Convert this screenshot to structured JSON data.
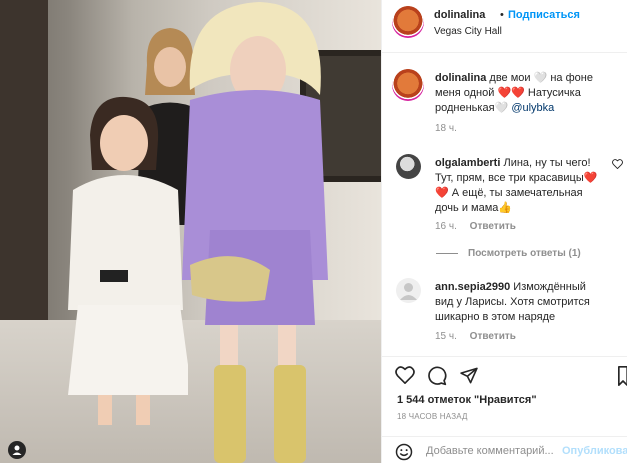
{
  "post_user": {
    "username": "dolinalina",
    "separator": "•",
    "follow_label": "Подписаться",
    "location": "Vegas City Hall"
  },
  "caption": {
    "username": "dolinalina",
    "text": "две мои 🤍 на фоне меня одной ❤️❤️ Натусичка родненькая🤍",
    "mention": "@ulybka",
    "time": "18 ч."
  },
  "comments": [
    {
      "username": "olgalamberti",
      "text": "Лина, ну ты чего! Тут, прям, все три красавицы❤️❤️ А ещё, ты замечательная дочь и мама👍",
      "time": "16 ч.",
      "reply_label": "Ответить"
    },
    {
      "username": "ann.sepia2990",
      "text": "Измождённый вид у Ларисы. Хотя смотрится шикарно в этом наряде",
      "time": "15 ч.",
      "reply_label": "Ответить"
    }
  ],
  "replies": {
    "label": "Посмотреть ответы (1)"
  },
  "actions": {
    "like_icon": "heart-icon",
    "comment_icon": "comment-icon",
    "share_icon": "share-icon",
    "save_icon": "bookmark-icon"
  },
  "likes": "1 544 отметок \"Нравится\"",
  "post_time": "18 ЧАСОВ НАЗАД",
  "add_comment": {
    "placeholder": "Добавьте комментарий...",
    "publish_label": "Опубликовать"
  },
  "colors": {
    "accent": "#0095f6",
    "muted": "#8e8e8e",
    "text": "#262626",
    "publish_disabled": "#b2dffc"
  }
}
